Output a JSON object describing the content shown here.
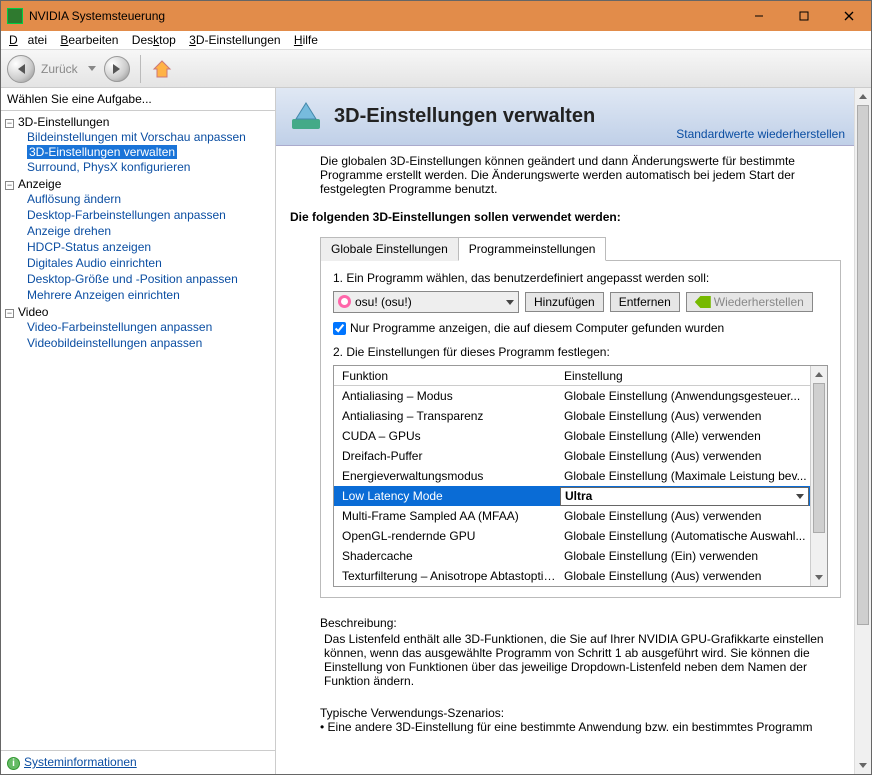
{
  "window": {
    "title": "NVIDIA Systemsteuerung"
  },
  "menu": {
    "file": "Datei",
    "edit": "Bearbeiten",
    "desktop": "Desktop",
    "settings3d": "3D-Einstellungen",
    "help": "Hilfe"
  },
  "toolbar": {
    "back": "Zurück"
  },
  "side": {
    "header": "Wählen Sie eine Aufgabe...",
    "groups": [
      {
        "label": "3D-Einstellungen",
        "items": [
          "Bildeinstellungen mit Vorschau anpassen",
          "3D-Einstellungen verwalten",
          "Surround, PhysX konfigurieren"
        ],
        "selectedIndex": 1
      },
      {
        "label": "Anzeige",
        "items": [
          "Auflösung ändern",
          "Desktop-Farbeinstellungen anpassen",
          "Anzeige drehen",
          "HDCP-Status anzeigen",
          "Digitales Audio einrichten",
          "Desktop-Größe und -Position anpassen",
          "Mehrere Anzeigen einrichten"
        ]
      },
      {
        "label": "Video",
        "items": [
          "Video-Farbeinstellungen anpassen",
          "Videobildeinstellungen anpassen"
        ]
      }
    ],
    "sysinfo": "Systeminformationen"
  },
  "banner": {
    "title": "3D-Einstellungen verwalten",
    "restore": "Standardwerte wiederherstellen"
  },
  "intro": "Die globalen 3D-Einstellungen können geändert und dann Änderungswerte für bestimmte Programme erstellt werden. Die Änderungswerte werden automatisch bei jedem Start der festgelegten Programme benutzt.",
  "sectionTitle": "Die folgenden 3D-Einstellungen sollen verwendet werden:",
  "tabs": {
    "global": "Globale Einstellungen",
    "program": "Programmeinstellungen"
  },
  "step1": "1. Ein Programm wählen, das benutzerdefiniert angepasst werden soll:",
  "program": "osu! (osu!)",
  "buttons": {
    "add": "Hinzufügen",
    "remove": "Entfernen",
    "restore": "Wiederherstellen"
  },
  "checkbox": "Nur Programme anzeigen, die auf diesem Computer gefunden wurden",
  "step2": "2. Die Einstellungen für dieses Programm festlegen:",
  "gridHead": {
    "c1": "Funktion",
    "c2": "Einstellung"
  },
  "rows": [
    {
      "f": "Antialiasing – Modus",
      "s": "Globale Einstellung (Anwendungsgesteuer..."
    },
    {
      "f": "Antialiasing – Transparenz",
      "s": "Globale Einstellung (Aus) verwenden"
    },
    {
      "f": "CUDA – GPUs",
      "s": "Globale Einstellung (Alle) verwenden"
    },
    {
      "f": "Dreifach-Puffer",
      "s": "Globale Einstellung (Aus) verwenden"
    },
    {
      "f": "Energieverwaltungsmodus",
      "s": "Globale Einstellung (Maximale Leistung bev..."
    },
    {
      "f": "Low Latency Mode",
      "s": "Ultra",
      "sel": true
    },
    {
      "f": "Multi-Frame Sampled AA (MFAA)",
      "s": "Globale Einstellung (Aus) verwenden"
    },
    {
      "f": "OpenGL-rendernde GPU",
      "s": "Globale Einstellung (Automatische Auswahl..."
    },
    {
      "f": "Shadercache",
      "s": "Globale Einstellung (Ein) verwenden"
    },
    {
      "f": "Texturfilterung – Anisotrope Abtastoptimi...",
      "s": "Globale Einstellung (Aus) verwenden"
    }
  ],
  "desc": {
    "title": "Beschreibung:",
    "body": "Das Listenfeld enthält alle 3D-Funktionen, die Sie auf Ihrer NVIDIA GPU-Grafikkarte einstellen können, wenn das ausgewählte Programm von Schritt 1 ab ausgeführt wird. Sie können die Einstellung von Funktionen über das jeweilige Dropdown-Listenfeld neben dem Namen der Funktion ändern."
  },
  "scenarios": {
    "title": "Typische Verwendungs-Szenarios:",
    "bullet": "• Eine andere 3D-Einstellung für eine bestimmte Anwendung bzw. ein bestimmtes Programm"
  }
}
